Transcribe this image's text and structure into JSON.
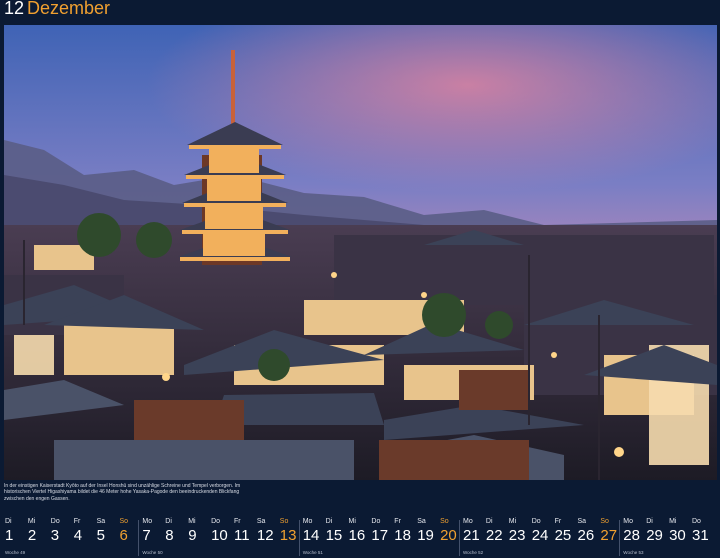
{
  "header": {
    "month_number": "12",
    "month_name": "Dezember"
  },
  "colors": {
    "accent": "#f0a030",
    "background": "#0b1a33"
  },
  "photo": {
    "subject": "pagoda-cityscape-image"
  },
  "caption": "In der einstigen Kaiserstadt Kyōto auf der Insel Honshū sind unzählige Schreine und Tempel verborgen. Im historischen Viertel Higashiyama bildet die 46 Meter hohe Yasaka-Pagode den beeindruckenden Blickfang zwischen den engen Gassen.",
  "calendar": {
    "days": [
      {
        "dow": "Di",
        "num": "1",
        "sunday": false
      },
      {
        "dow": "Mi",
        "num": "2",
        "sunday": false
      },
      {
        "dow": "Do",
        "num": "3",
        "sunday": false
      },
      {
        "dow": "Fr",
        "num": "4",
        "sunday": false
      },
      {
        "dow": "Sa",
        "num": "5",
        "sunday": false
      },
      {
        "dow": "So",
        "num": "6",
        "sunday": true
      },
      {
        "dow": "Mo",
        "num": "7",
        "sunday": false
      },
      {
        "dow": "Di",
        "num": "8",
        "sunday": false
      },
      {
        "dow": "Mi",
        "num": "9",
        "sunday": false
      },
      {
        "dow": "Do",
        "num": "10",
        "sunday": false
      },
      {
        "dow": "Fr",
        "num": "11",
        "sunday": false
      },
      {
        "dow": "Sa",
        "num": "12",
        "sunday": false
      },
      {
        "dow": "So",
        "num": "13",
        "sunday": true
      },
      {
        "dow": "Mo",
        "num": "14",
        "sunday": false
      },
      {
        "dow": "Di",
        "num": "15",
        "sunday": false
      },
      {
        "dow": "Mi",
        "num": "16",
        "sunday": false
      },
      {
        "dow": "Do",
        "num": "17",
        "sunday": false
      },
      {
        "dow": "Fr",
        "num": "18",
        "sunday": false
      },
      {
        "dow": "Sa",
        "num": "19",
        "sunday": false
      },
      {
        "dow": "So",
        "num": "20",
        "sunday": true
      },
      {
        "dow": "Mo",
        "num": "21",
        "sunday": false
      },
      {
        "dow": "Di",
        "num": "22",
        "sunday": false
      },
      {
        "dow": "Mi",
        "num": "23",
        "sunday": false
      },
      {
        "dow": "Do",
        "num": "24",
        "sunday": false
      },
      {
        "dow": "Fr",
        "num": "25",
        "sunday": false
      },
      {
        "dow": "Sa",
        "num": "26",
        "sunday": false
      },
      {
        "dow": "So",
        "num": "27",
        "sunday": true
      },
      {
        "dow": "Mo",
        "num": "28",
        "sunday": false
      },
      {
        "dow": "Di",
        "num": "29",
        "sunday": false
      },
      {
        "dow": "Mi",
        "num": "30",
        "sunday": false
      },
      {
        "dow": "Do",
        "num": "31",
        "sunday": false
      }
    ],
    "weeks": [
      {
        "label": "Woche 49",
        "day_index": 0
      },
      {
        "label": "Woche 50",
        "day_index": 6
      },
      {
        "label": "Woche 51",
        "day_index": 13
      },
      {
        "label": "Woche 52",
        "day_index": 20
      },
      {
        "label": "Woche 53",
        "day_index": 27
      }
    ]
  }
}
